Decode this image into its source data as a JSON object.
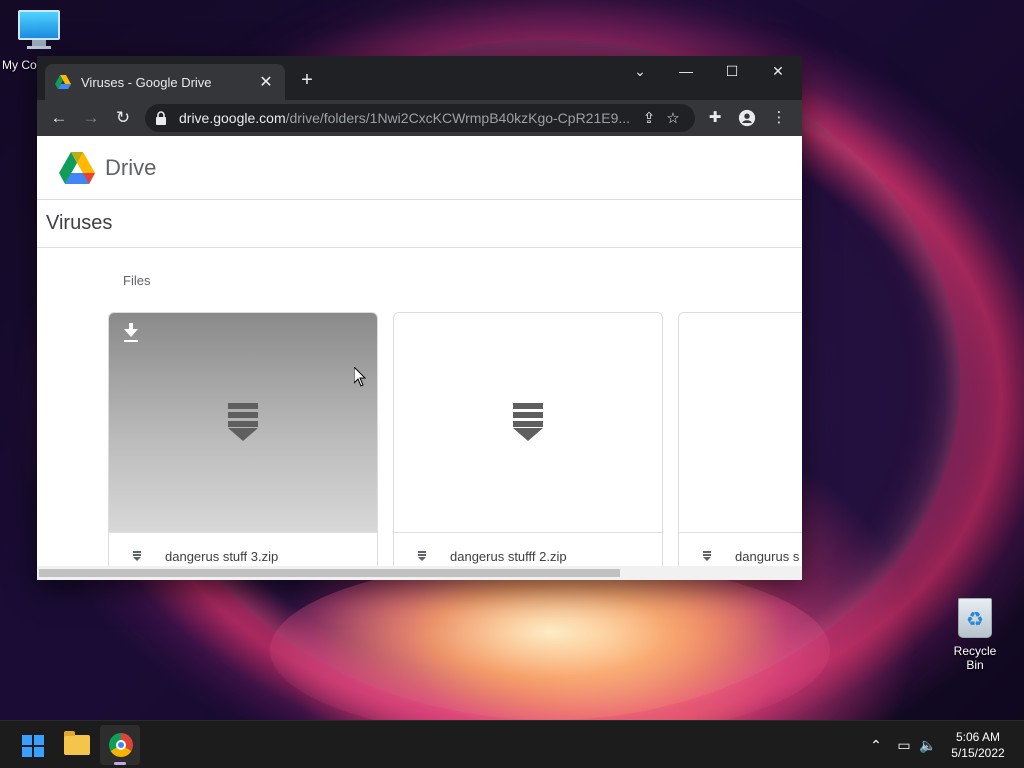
{
  "desktop": {
    "icons": [
      {
        "label": "My Co"
      },
      {
        "label": "Recycle Bin"
      }
    ]
  },
  "browser": {
    "tab": {
      "title": "Viruses - Google Drive"
    },
    "new_tab_symbol": "+",
    "window_controls": {
      "tab_search": "⌄",
      "minimize": "—",
      "maximize": "☐",
      "close": "✕"
    },
    "nav": {
      "back": "←",
      "forward": "→",
      "reload": "↻"
    },
    "url": {
      "host": "drive.google.com",
      "path": "/drive/folders/1Nwi2CxcKCWrmpB40kzKgo-CpR21E9..."
    },
    "icons": [
      "lock-icon",
      "share-icon",
      "star-icon",
      "extensions-icon",
      "profile-icon",
      "menu-icon"
    ]
  },
  "drive": {
    "brand": "Drive",
    "folder_title": "Viruses",
    "section_label": "Files",
    "files": [
      {
        "name": "dangerus stuff 3.zip"
      },
      {
        "name": "dangerus stufff 2.zip"
      },
      {
        "name": "dangurus s"
      }
    ]
  },
  "taskbar": {
    "apps": [
      "start",
      "file-explorer",
      "chrome"
    ],
    "clock": {
      "time": "5:06 AM",
      "date": "5/15/2022"
    }
  },
  "colors": {
    "accent": "#3aa0ff",
    "chrome_bar": "#35363a",
    "title_bar": "#202124"
  }
}
